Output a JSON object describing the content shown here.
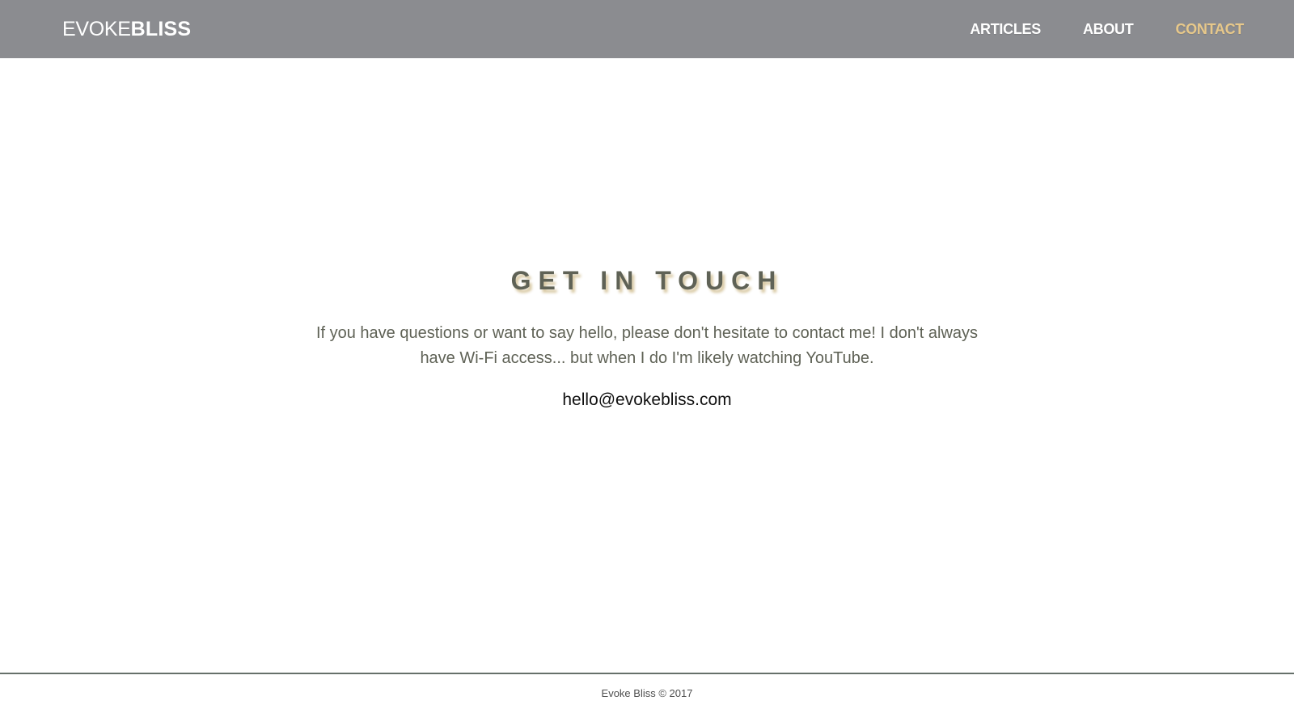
{
  "header": {
    "brand_light": "EVOKE",
    "brand_bold": "BLISS",
    "nav": [
      {
        "label": "ARTICLES",
        "active": false
      },
      {
        "label": "ABOUT",
        "active": false
      },
      {
        "label": "CONTACT",
        "active": true
      }
    ]
  },
  "contact": {
    "title": "GET IN TOUCH",
    "body": "If you have questions or want to say hello, please don't hesitate to contact me! I don't always have Wi-Fi access... but when I do I'm likely watching YouTube.",
    "email": "hello@evokebliss.com"
  },
  "footer": {
    "text": "Evoke Bliss © 2017"
  },
  "colors": {
    "header_bg": "#8b8c90",
    "active_link": "#e7c88a",
    "heading_text": "#5f6256",
    "heading_shadow": "#d6c59d",
    "footer_line": "#66706a"
  }
}
